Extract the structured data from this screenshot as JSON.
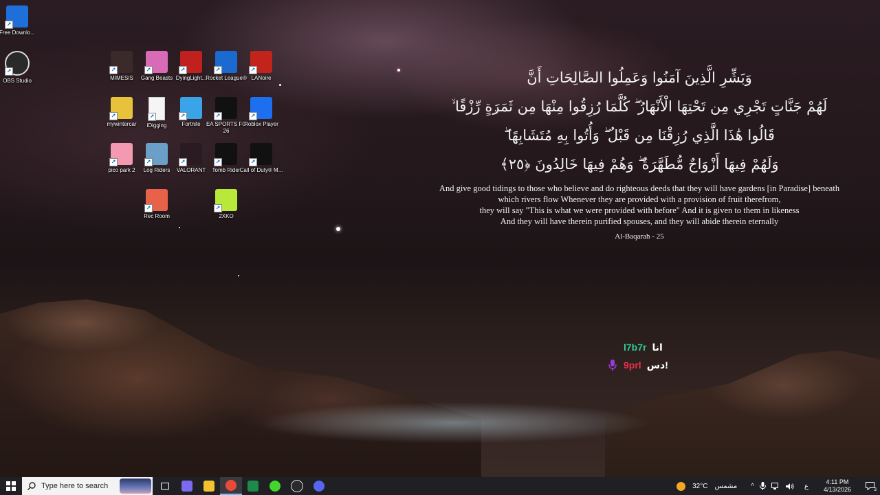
{
  "desktop_icons": [
    {
      "label": "Free Downlo...",
      "icon": "free-download-manager-icon",
      "color": "#1e6fd9"
    },
    {
      "label": "OBS Studio",
      "icon": "obs-studio-icon",
      "color": "#2a2a2a"
    },
    {
      "label": "MIMESIS",
      "icon": "mimesis-icon",
      "color": "#3a2a2a"
    },
    {
      "label": "Gang Beasts",
      "icon": "gang-beasts-icon",
      "color": "#d86ab8"
    },
    {
      "label": "DyingLight...",
      "icon": "dying-light-icon",
      "color": "#c0201e"
    },
    {
      "label": "Rocket League®",
      "icon": "rocket-league-icon",
      "color": "#1a6ad0"
    },
    {
      "label": "LANoire",
      "icon": "la-noire-icon",
      "color": "#c2241b"
    },
    {
      "label": "mywintercar",
      "icon": "my-winter-car-icon",
      "color": "#e8c23a"
    },
    {
      "label": "iDigging",
      "icon": "file-icon",
      "color": "#f5f5f5"
    },
    {
      "label": "Fortnite",
      "icon": "fortnite-icon",
      "color": "#3aa4e8"
    },
    {
      "label": "EA SPORTS FC 26",
      "icon": "ea-sports-fc-icon",
      "color": "#111111"
    },
    {
      "label": "Roblox Player",
      "icon": "roblox-icon",
      "color": "#1e6ef0"
    },
    {
      "label": "pico park 2",
      "icon": "pico-park-icon",
      "color": "#f39ab0"
    },
    {
      "label": "Log Riders",
      "icon": "log-riders-icon",
      "color": "#6aa0c8"
    },
    {
      "label": "VALORANT",
      "icon": "valorant-icon",
      "color": "#2a1a22"
    },
    {
      "label": "Tomb Rider",
      "icon": "tomb-raider-icon",
      "color": "#111111"
    },
    {
      "label": "Call of Duty® M...",
      "icon": "call-of-duty-icon",
      "color": "#111111"
    },
    {
      "label": "Rec Room",
      "icon": "rec-room-icon",
      "color": "#e8624a"
    },
    {
      "label": "2XKO",
      "icon": "2xko-icon",
      "color": "#b8e83a"
    }
  ],
  "verse": {
    "arabic_lines": [
      "وَبَشِّرِ الَّذِينَ آمَنُوا وَعَمِلُوا الصَّالِحَاتِ أَنَّ",
      "لَهُمْ جَنَّاتٍ تَجْرِي مِن تَحْتِهَا الْأَنْهَارُ ۖ كُلَّمَا رُزِقُوا مِنْهَا مِن ثَمَرَةٍ رِّزْقًا ۙ",
      "قَالُوا هَٰذَا الَّذِي رُزِقْنَا مِن قَبْلُ ۖ وَأُتُوا بِهِ مُتَشَابِهًا ۖ",
      "وَلَهُمْ فِيهَا أَزْوَاجٌ مُّطَهَّرَةٌ ۖ وَهُمْ فِيهَا خَالِدُونَ ﴿٢٥﴾"
    ],
    "translation_lines": [
      "And give good tidings to those who believe and do righteous deeds that they will have gardens [in Paradise] beneath",
      "which rivers flow Whenever they are provided with a provision of fruit therefrom,",
      "they will say \"This is what we were provided with before\" And it is given to them in likeness",
      "And they will have therein purified spouses, and they will abide therein eternally"
    ],
    "reference": "Al-Baqarah - 25"
  },
  "voice_overlay": {
    "rows": [
      {
        "name": "l7b7r",
        "tag": "انا",
        "name_color": "#2ecc9a",
        "speaking": false
      },
      {
        "name": "9prl",
        "tag": "دس!",
        "name_color": "#e8304a",
        "speaking": true,
        "mic_color": "#9b3ad8"
      }
    ]
  },
  "taskbar": {
    "search_placeholder": "Type here to search",
    "pinned_apps": [
      {
        "name": "task-view-icon",
        "color": "#ffffff"
      },
      {
        "name": "copilot-icon",
        "color": "#7a6af0"
      },
      {
        "name": "file-explorer-icon",
        "color": "#f2c230"
      },
      {
        "name": "chrome-icon",
        "color": "#e84a3a"
      },
      {
        "name": "excel-icon",
        "color": "#1e8a4a"
      },
      {
        "name": "razer-cortex-icon",
        "color": "#44d62c"
      },
      {
        "name": "obs-taskbar-icon",
        "color": "#2a2a2a"
      },
      {
        "name": "discord-icon",
        "color": "#5865f2"
      }
    ],
    "weather_temp": "32°C",
    "weather_desc": "مشمس",
    "input_lang": "ع",
    "time": "4:11 PM",
    "date": "4/13/2026",
    "notification_count": "3"
  }
}
